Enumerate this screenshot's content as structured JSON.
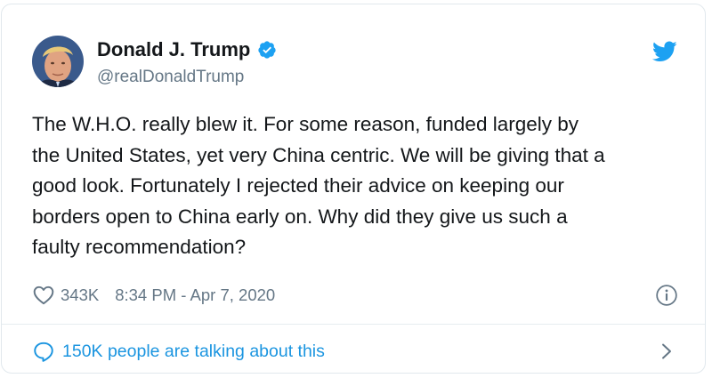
{
  "author": {
    "name": "Donald J. Trump",
    "handle": "@realDonaldTrump",
    "verified": true,
    "avatar_icon": "profile-photo"
  },
  "tweet": {
    "lines": [
      "The W.H.O. really blew it. For some reason, funded largely by",
      "the United States, yet very China centric. We will be giving that a",
      "good look. Fortunately I rejected their advice on keeping our",
      "borders open to China early on. Why did they give us such a",
      "faulty recommendation?"
    ]
  },
  "meta": {
    "likes": "343K",
    "timestamp": "8:34 PM - Apr 7, 2020"
  },
  "footer": {
    "talking": "150K people are talking about this"
  },
  "colors": {
    "accent": "#1b95e0",
    "twitter_blue": "#1da1f2",
    "text": "#14171a",
    "muted": "#657786",
    "border": "#e1e8ed"
  },
  "icons": {
    "brand": "twitter-bird-icon",
    "verified": "verified-badge-icon",
    "like": "heart-icon",
    "info": "info-icon",
    "reply": "speech-bubble-icon",
    "navigate": "chevron-right-icon"
  }
}
